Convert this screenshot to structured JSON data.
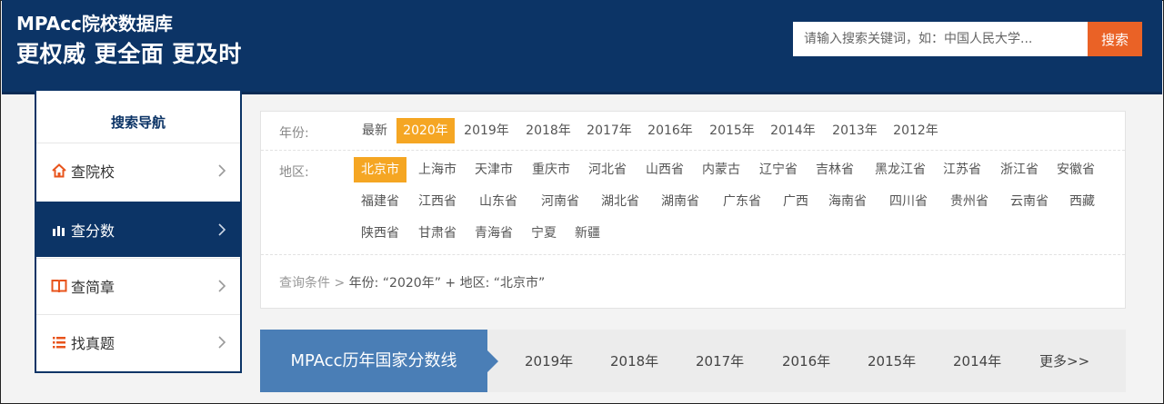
{
  "header": {
    "brand_title": "MPAcc院校数据库",
    "slogan": "更权威 更全面 更及时",
    "search_placeholder": "请输入搜索关键词，如：中国人民大学...",
    "search_button": "搜索",
    "colors": {
      "navy": "#0c3466",
      "orange": "#ea6226"
    }
  },
  "sidebar": {
    "title": "搜索导航",
    "items": [
      {
        "label": "查院校",
        "icon": "home-icon",
        "active": false
      },
      {
        "label": "查分数",
        "icon": "bar-chart-icon",
        "active": true
      },
      {
        "label": "查简章",
        "icon": "book-icon",
        "active": false
      },
      {
        "label": "找真题",
        "icon": "list-icon",
        "active": false
      }
    ]
  },
  "filter": {
    "year_label": "年份:",
    "years": [
      "最新",
      "2020年",
      "2019年",
      "2018年",
      "2017年",
      "2016年",
      "2015年",
      "2014年",
      "2013年",
      "2012年"
    ],
    "selected_year": "2020年",
    "region_label": "地区:",
    "regions": [
      [
        "北京市",
        "上海市",
        "天津市",
        "重庆市",
        "河北省",
        "山西省",
        "内蒙古",
        "辽宁省",
        "吉林省",
        "黑龙江省",
        "江苏省",
        "浙江省",
        "安徽省"
      ],
      [
        "福建省",
        "江西省",
        "山东省",
        "河南省",
        "湖北省",
        "湖南省",
        "广东省",
        "广西",
        "海南省",
        "四川省",
        "贵州省",
        "云南省",
        "西藏"
      ],
      [
        "陕西省",
        "甘肃省",
        "青海省",
        "宁夏",
        "新疆"
      ]
    ],
    "selected_region": "北京市",
    "accent_color": "#f5a623",
    "crumb_prefix": "查询条件 >",
    "crumb_year": "年份: “2020年”",
    "crumb_plus": "+ 地区: “北京市”"
  },
  "scores": {
    "title": "MPAcc历年国家分数线",
    "years": [
      "2019年",
      "2018年",
      "2017年",
      "2016年",
      "2015年",
      "2014年"
    ],
    "more": "更多>>",
    "title_color": "#4a7eb6"
  }
}
